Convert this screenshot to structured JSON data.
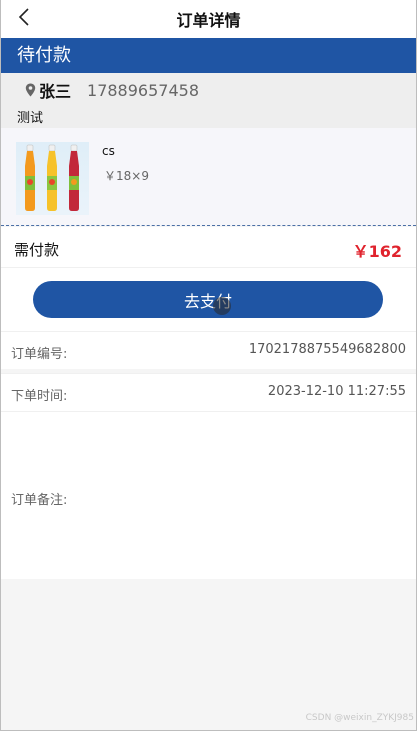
{
  "header": {
    "title": "订单详情",
    "back_icon": "chevron-left-icon"
  },
  "status": {
    "label": "待付款",
    "color": "#1f55a4"
  },
  "address": {
    "name": "张三",
    "phone": "17889657458",
    "detail": "测试",
    "icon": "location-pin-icon"
  },
  "goods": {
    "name": "cs",
    "price_qty": "￥18×9",
    "image": "juice-bottles-image"
  },
  "amount": {
    "label": "需付款",
    "value": "￥162",
    "color": "#e0232d"
  },
  "pay_button": {
    "label": "去支付"
  },
  "info": [
    {
      "label": "订单编号:",
      "value": "1702178875549682800"
    },
    {
      "label": "下单时间:",
      "value": "2023-12-10 11:27:55"
    }
  ],
  "remark": {
    "label": "订单备注:"
  },
  "watermark": "CSDN @weixin_ZYKJ985"
}
